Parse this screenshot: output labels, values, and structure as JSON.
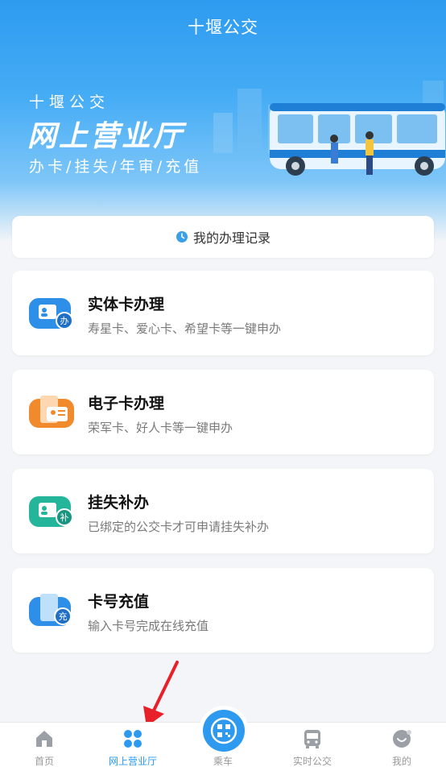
{
  "header": {
    "app_title": "十堰公交",
    "hero_sub": "十堰公交",
    "hero_main": "网上营业厅",
    "hero_tagline": "办卡/挂失/年审/充值"
  },
  "record": {
    "label": "我的办理记录",
    "icon": "clock-icon"
  },
  "services": [
    {
      "title": "实体卡办理",
      "desc": "寿星卡、爱心卡、希望卡等一键申办",
      "badge": "办",
      "color": "#2d8fe8"
    },
    {
      "title": "电子卡办理",
      "desc": "荣军卡、好人卡等一键申办",
      "badge": "",
      "color": "#f08a2c"
    },
    {
      "title": "挂失补办",
      "desc": "已绑定的公交卡才可申请挂失补办",
      "badge": "补",
      "color": "#25b59a"
    },
    {
      "title": "卡号充值",
      "desc": "输入卡号完成在线充值",
      "badge": "充",
      "color": "#2d8fe8"
    }
  ],
  "tabbar": {
    "items": [
      {
        "label": "首页",
        "icon": "home-icon"
      },
      {
        "label": "网上营业厅",
        "icon": "grid-dots-icon",
        "active": true
      },
      {
        "label": "乘车",
        "icon": "qr-code-icon"
      },
      {
        "label": "实时公交",
        "icon": "bus-icon"
      },
      {
        "label": "我的",
        "icon": "profile-icon"
      }
    ]
  },
  "colors": {
    "accent": "#2d9af0",
    "arrow": "#e8202a"
  }
}
